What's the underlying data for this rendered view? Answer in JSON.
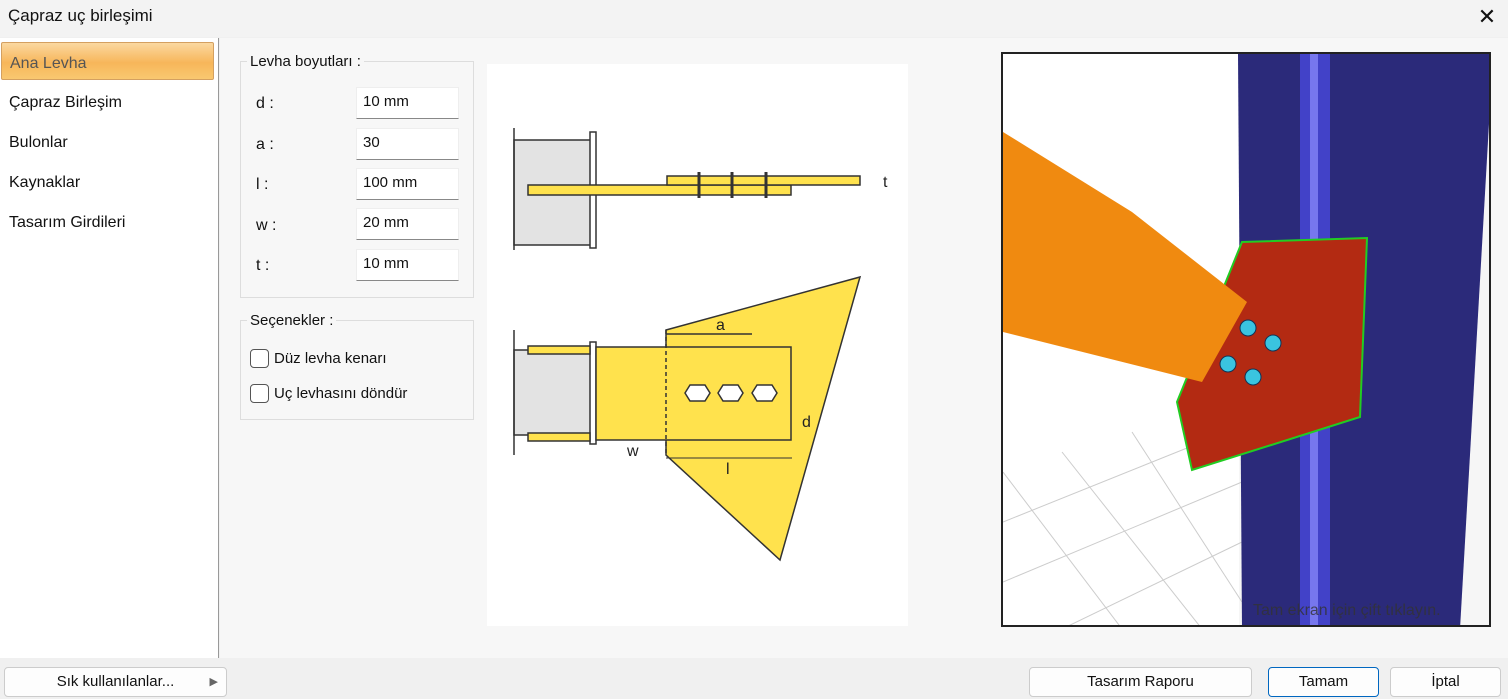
{
  "window": {
    "title": "Çapraz uç birleşimi",
    "close_icon": "close-icon"
  },
  "sidebar": {
    "items": [
      {
        "label": "Ana Levha",
        "selected": true
      },
      {
        "label": "Çapraz Birleşim"
      },
      {
        "label": "Bulonlar"
      },
      {
        "label": "Kaynaklar"
      },
      {
        "label": "Tasarım Girdileri"
      }
    ]
  },
  "dimensions": {
    "title": "Levha boyutları :",
    "fields": [
      {
        "label": "d :",
        "value": "10 mm"
      },
      {
        "label": "a :",
        "value": "30"
      },
      {
        "label": "l :",
        "value": "100 mm"
      },
      {
        "label": "w :",
        "value": "20 mm"
      },
      {
        "label": "t :",
        "value": "10 mm"
      }
    ]
  },
  "options": {
    "title": "Seçenekler :",
    "items": [
      {
        "label": "Düz levha kenarı",
        "checked": false
      },
      {
        "label": "Uç levhasını döndür",
        "checked": false
      }
    ]
  },
  "diagram": {
    "labels": {
      "t": "t",
      "a": "a",
      "d": "d",
      "w": "w",
      "l": "l"
    }
  },
  "viewport": {
    "hint": "Tam ekran için çift tıklayın."
  },
  "footer": {
    "favorites": "Sık kullanılanlar...",
    "report": "Tasarım Raporu",
    "ok": "Tamam",
    "cancel": "İptal"
  },
  "colors": {
    "plate": "#ffe24d",
    "selected": "#f7b65a",
    "column": "#2b2a7a",
    "brace": "#f08a10",
    "gusset": "#b32a12"
  }
}
